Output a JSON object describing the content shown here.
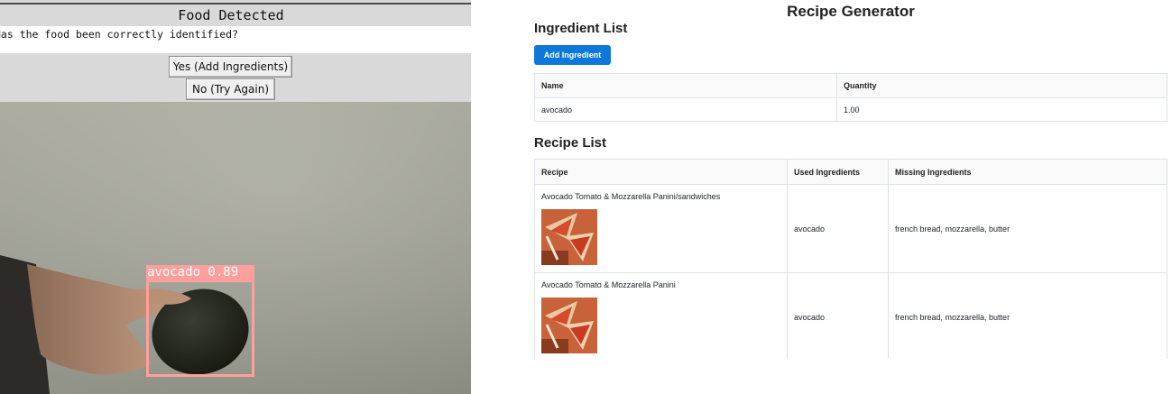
{
  "detection_window": {
    "title": "Food Detected",
    "question": "Has the food been correctly identified?",
    "yes_button": "Yes (Add Ingredients)",
    "no_button": "No (Try Again)",
    "detection_label": "avocado 0.89",
    "box_color": "#ff9f9c"
  },
  "recipe_generator": {
    "title": "Recipe Generator",
    "ingredient_section_title": "Ingredient List",
    "add_ingredient_label": "Add Ingredient",
    "accent_color": "#0d78d9",
    "ingredient_table": {
      "headers": [
        "Name",
        "Quantity"
      ],
      "rows": [
        {
          "name": "avocado",
          "quantity": "1.00"
        }
      ]
    },
    "recipe_section_title": "Recipe List",
    "recipe_table": {
      "headers": [
        "Recipe",
        "Used Ingredients",
        "Missing Ingredients"
      ],
      "rows": [
        {
          "recipe": "Avocado Tomato & Mozzarella Panini/sandwiches",
          "used": "avocado",
          "missing": "french bread, mozzarella, butter"
        },
        {
          "recipe": "Avocado Tomato & Mozzarella Panini",
          "used": "avocado",
          "missing": "french bread, mozzarella, butter"
        }
      ]
    }
  }
}
